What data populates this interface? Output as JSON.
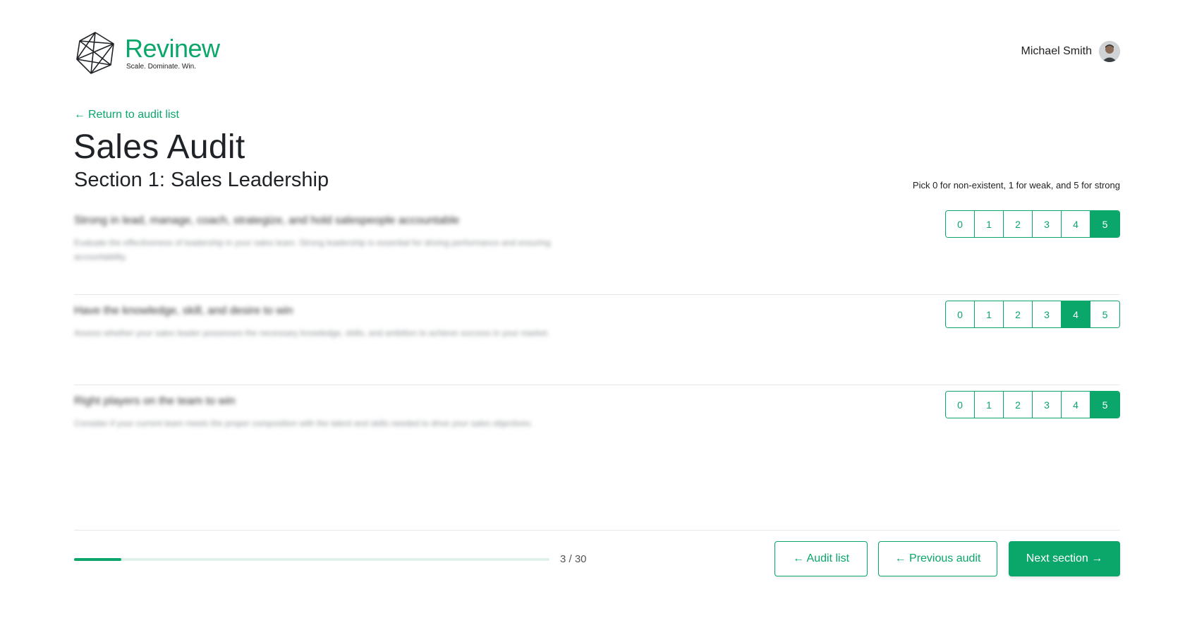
{
  "header": {
    "logo_name": "Revinew",
    "logo_tagline": "Scale. Dominate. Win.",
    "user_name": "Michael Smith"
  },
  "nav": {
    "back_arrow": "←",
    "back_label": "Return to audit list"
  },
  "page": {
    "title": "Sales Audit",
    "section_title": "Section 1: Sales Leadership",
    "hint": "Pick 0 for non-existent, 1 for weak, and 5 for strong"
  },
  "rating_options": [
    "0",
    "1",
    "2",
    "3",
    "4",
    "5"
  ],
  "questions": [
    {
      "title": "Strong in lead, manage, coach, strategize, and hold salespeople accountable",
      "description": "Evaluate the effectiveness of leadership in your sales team. Strong leadership is essential for driving performance and ensuring accountability.",
      "selected": "5"
    },
    {
      "title": "Have the knowledge, skill, and desire to win",
      "description": "Assess whether your sales leader possesses the necessary knowledge, skills, and ambition to achieve success in your market.",
      "selected": "4"
    },
    {
      "title": "Right players on the team to win",
      "description": "Consider if your current team meets the proper composition with the talent and skills needed to drive your sales objectives.",
      "selected": "5"
    }
  ],
  "progress": {
    "current": 3,
    "total": 30,
    "label": "3 / 30"
  },
  "buttons": {
    "audit_list": "← Audit list",
    "previous_audit": "← Previous audit",
    "next_section": "Next section →"
  },
  "colors": {
    "accent": "#0aa66a",
    "track": "#dff1ea",
    "divider": "#e6e9ea"
  }
}
